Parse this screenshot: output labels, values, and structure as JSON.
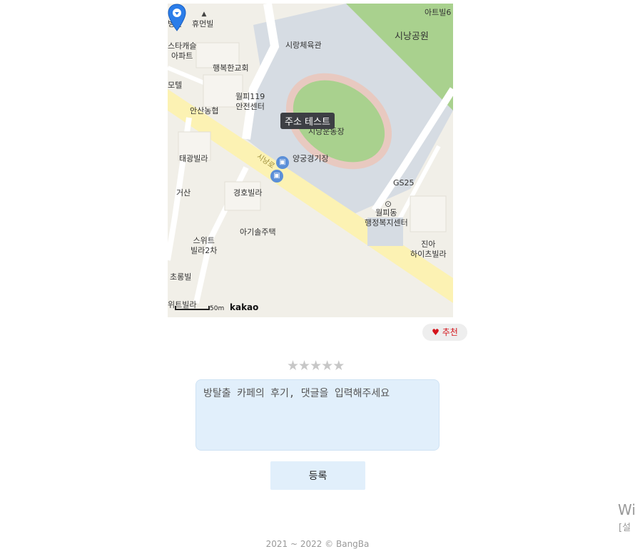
{
  "map": {
    "tooltip": "주소 테스트",
    "provider": "kakao",
    "scale": "50m",
    "labels": [
      {
        "id": "hospital",
        "text": "병원"
      },
      {
        "id": "humanbil",
        "text": "휴먼빌"
      },
      {
        "id": "startacastle",
        "text": "스타캐슬\n아파트"
      },
      {
        "id": "motel",
        "text": "모텔"
      },
      {
        "id": "haengbok",
        "text": "행복한교회"
      },
      {
        "id": "gymnasium",
        "text": "시랑체육관"
      },
      {
        "id": "park",
        "text": "시낭공원"
      },
      {
        "id": "artvil",
        "text": "아트빌6"
      },
      {
        "id": "fire",
        "text": "월피119\n안전센터"
      },
      {
        "id": "nonghyup",
        "text": "안산농협"
      },
      {
        "id": "stadium",
        "text": "시낭운동장"
      },
      {
        "id": "archery",
        "text": "양궁경기장"
      },
      {
        "id": "taegwang",
        "text": "태광빌라"
      },
      {
        "id": "geosan",
        "text": "거산"
      },
      {
        "id": "gyeongho",
        "text": "경호빌라"
      },
      {
        "id": "gs25",
        "text": "GS25"
      },
      {
        "id": "welfare",
        "text": "월피동\n행정복지센터"
      },
      {
        "id": "agisol",
        "text": "아기솔주택"
      },
      {
        "id": "suite",
        "text": "스위트\n빌라2차"
      },
      {
        "id": "jinah",
        "text": "진아\n하이츠빌라"
      },
      {
        "id": "chorong",
        "text": "초롱빌"
      },
      {
        "id": "wibil",
        "text": "위트빌라"
      },
      {
        "id": "road",
        "text": "시낭로"
      }
    ]
  },
  "recommend": {
    "label": "추천",
    "icon": "heart-icon",
    "color": "#d4141b"
  },
  "rating": {
    "stars": 5,
    "filled": 0,
    "icon": "star-icon"
  },
  "comment": {
    "placeholder": "방탈출 카페의 후기, 댓글을 입력해주세요",
    "value": ""
  },
  "submit": {
    "label": "등록"
  },
  "footer": {
    "text": "2021 ~ 2022 © BangBa"
  },
  "watermark": {
    "line1": "Wi",
    "line2": "[설"
  }
}
